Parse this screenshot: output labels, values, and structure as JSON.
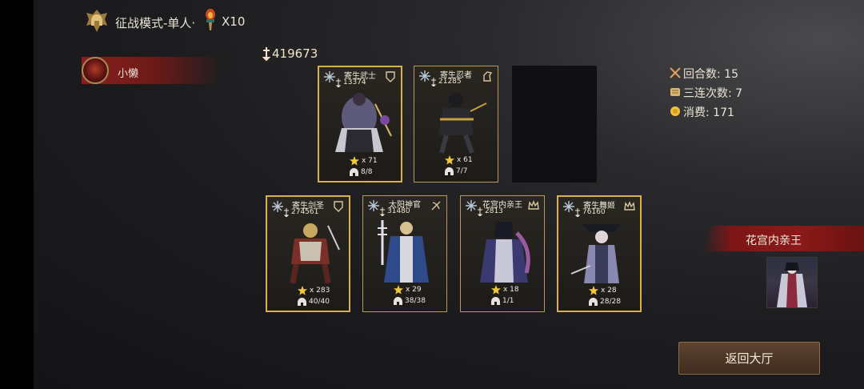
{
  "header": {
    "mode_title": "征战模式-单人·",
    "ticket_count": "X10"
  },
  "player": {
    "name": "小懒"
  },
  "team": {
    "total_power": "419673"
  },
  "cards": [
    {
      "name": "寄生武士",
      "power": "13374",
      "stars": "x 71",
      "count": "8/8",
      "highlighted": true
    },
    {
      "name": "寄生忍者",
      "power": "21285",
      "stars": "x 61",
      "count": "7/7",
      "highlighted": false
    },
    {
      "name": "寄生剑圣",
      "power": "274561",
      "stars": "x 283",
      "count": "40/40",
      "highlighted": true
    },
    {
      "name": "太阳神官",
      "power": "31480",
      "stars": "x 29",
      "count": "38/38",
      "highlighted": false
    },
    {
      "name": "花宫内亲王",
      "power": "2813",
      "stars": "x 18",
      "count": "1/1",
      "highlighted": false
    },
    {
      "name": "寄生舞姬",
      "power": "76160",
      "stars": "x 28",
      "count": "28/28",
      "highlighted": true
    }
  ],
  "stats": {
    "rounds": "回合数: 15",
    "triple_streak": "三连次数: 7",
    "cost": "消费: 171"
  },
  "featured": {
    "name": "花宫内亲王"
  },
  "buttons": {
    "return_label": "返回大厅"
  },
  "colors": {
    "accent_gold": "#d8b14a",
    "banner_red": "#8a1f1c",
    "button_brown": "#4d3727"
  }
}
